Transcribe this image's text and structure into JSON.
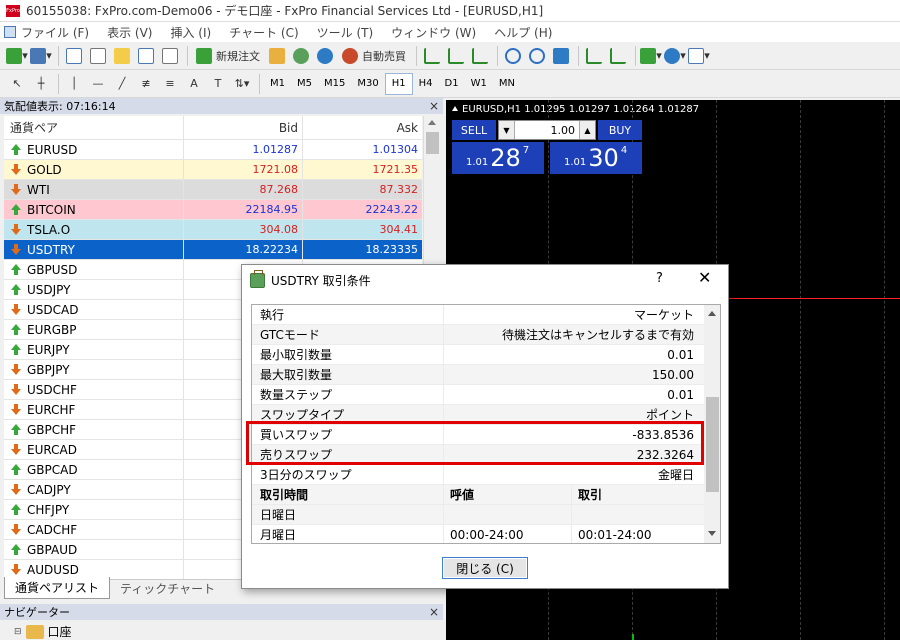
{
  "window": {
    "logo_text": "FxPro",
    "title": "60155038: FxPro.com-Demo06 - デモ口座 - FxPro Financial Services Ltd - [EURUSD,H1]"
  },
  "menu": [
    "ファイル (F)",
    "表示 (V)",
    "挿入 (I)",
    "チャート (C)",
    "ツール (T)",
    "ウィンドウ (W)",
    "ヘルプ (H)"
  ],
  "toolbar": {
    "new_order_label": "新規注文",
    "auto_trade_label": "自動売買",
    "timeframes": [
      "M1",
      "M5",
      "M15",
      "M30",
      "H1",
      "H4",
      "D1",
      "W1",
      "MN"
    ],
    "active_timeframe": "H1"
  },
  "market_watch": {
    "header": "気配値表示: 07:16:14",
    "columns": {
      "symbol": "通貨ペア",
      "bid": "Bid",
      "ask": "Ask"
    },
    "rows": [
      {
        "symbol": "EURUSD",
        "bid": "1.01287",
        "ask": "1.01304",
        "dir": "up"
      },
      {
        "symbol": "GOLD",
        "bid": "1721.08",
        "ask": "1721.35",
        "dir": "down"
      },
      {
        "symbol": "WTI",
        "bid": "87.268",
        "ask": "87.332",
        "dir": "down"
      },
      {
        "symbol": "BITCOIN",
        "bid": "22184.95",
        "ask": "22243.22",
        "dir": "up"
      },
      {
        "symbol": "TSLA.O",
        "bid": "304.08",
        "ask": "304.41",
        "dir": "down"
      },
      {
        "symbol": "USDTRY",
        "bid": "18.22234",
        "ask": "18.23335",
        "dir": "down"
      },
      {
        "symbol": "GBPUSD",
        "bid": "",
        "ask": "",
        "dir": "up"
      },
      {
        "symbol": "USDJPY",
        "bid": "",
        "ask": "",
        "dir": "up"
      },
      {
        "symbol": "USDCAD",
        "bid": "",
        "ask": "",
        "dir": "down"
      },
      {
        "symbol": "EURGBP",
        "bid": "",
        "ask": "",
        "dir": "up"
      },
      {
        "symbol": "EURJPY",
        "bid": "",
        "ask": "",
        "dir": "up"
      },
      {
        "symbol": "GBPJPY",
        "bid": "",
        "ask": "",
        "dir": "down"
      },
      {
        "symbol": "USDCHF",
        "bid": "",
        "ask": "",
        "dir": "down"
      },
      {
        "symbol": "EURCHF",
        "bid": "",
        "ask": "",
        "dir": "down"
      },
      {
        "symbol": "GBPCHF",
        "bid": "",
        "ask": "",
        "dir": "up"
      },
      {
        "symbol": "EURCAD",
        "bid": "",
        "ask": "",
        "dir": "down"
      },
      {
        "symbol": "GBPCAD",
        "bid": "",
        "ask": "",
        "dir": "up"
      },
      {
        "symbol": "CADJPY",
        "bid": "",
        "ask": "",
        "dir": "down"
      },
      {
        "symbol": "CHFJPY",
        "bid": "",
        "ask": "",
        "dir": "up"
      },
      {
        "symbol": "CADCHF",
        "bid": "",
        "ask": "",
        "dir": "down"
      },
      {
        "symbol": "GBPAUD",
        "bid": "",
        "ask": "",
        "dir": "up"
      },
      {
        "symbol": "AUDUSD",
        "bid": "",
        "ask": "",
        "dir": "down"
      }
    ],
    "tabs": [
      "通貨ペアリスト",
      "ティックチャート"
    ],
    "active_tab": "通貨ペアリスト"
  },
  "navigator": {
    "header": "ナビゲーター",
    "item": "口座"
  },
  "chart": {
    "title": "EURUSD,H1  1.01295 1.01297 1.01264 1.01287",
    "one_click": {
      "sell_label": "SELL",
      "buy_label": "BUY",
      "lot": "1.00",
      "sell_price": {
        "small": "1.01",
        "big": "28",
        "sup": "7"
      },
      "buy_price": {
        "small": "1.01",
        "big": "30",
        "sup": "4"
      }
    }
  },
  "dialog": {
    "title": "USDTRY 取引条件",
    "help": "?",
    "close_label": "閉じる (C)",
    "rows": [
      {
        "key": "執行",
        "value": "マーケット"
      },
      {
        "key": "GTCモード",
        "value": "待機注文はキャンセルするまで有効"
      },
      {
        "key": "最小取引数量",
        "value": "0.01"
      },
      {
        "key": "最大取引数量",
        "value": "150.00"
      },
      {
        "key": "数量ステップ",
        "value": "0.01"
      },
      {
        "key": "スワップタイプ",
        "value": "ポイント"
      },
      {
        "key": "買いスワップ",
        "value": "-833.8536"
      },
      {
        "key": "売りスワップ",
        "value": "232.3264"
      },
      {
        "key": "3日分のスワップ",
        "value": "金曜日"
      }
    ],
    "session_header": {
      "col1": "取引時間",
      "col2": "呼値",
      "col3": "取引"
    },
    "session_rows": [
      {
        "col1": "日曜日",
        "col2": "",
        "col3": ""
      },
      {
        "col1": "月曜日",
        "col2": "00:00-24:00",
        "col3": "00:01-24:00"
      }
    ]
  },
  "colors": {
    "bid_up": "#1a33d6",
    "bid_down": "#d62020",
    "selected_row": "#0b63c9",
    "gold_row": "#fff8d0",
    "wti_row": "#dcdcdc",
    "bitcoin_row": "#ffc7d0",
    "tsla_row": "#bfe6ef",
    "highlight": "#e00000",
    "one_click": "#1d3fb8"
  }
}
